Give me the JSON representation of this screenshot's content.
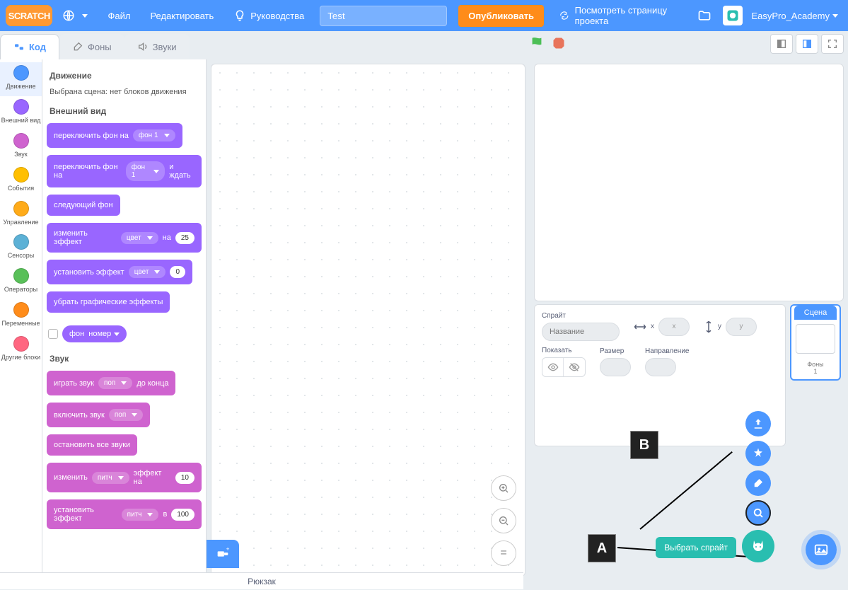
{
  "menubar": {
    "logo_text": "SCRATCH",
    "file": "Файл",
    "edit": "Редактировать",
    "tutorials": "Руководства",
    "project_name": "Test",
    "publish": "Опубликовать",
    "see_project": "Посмотреть страницу проекта",
    "username": "EasyPro_Academy"
  },
  "tabs": {
    "code": "Код",
    "backdrops": "Фоны",
    "sounds": "Звуки"
  },
  "categories": [
    {
      "label": "Движение",
      "color": "#4c97ff",
      "active": true
    },
    {
      "label": "Внешний вид",
      "color": "#9966ff"
    },
    {
      "label": "Звук",
      "color": "#cf63cf"
    },
    {
      "label": "События",
      "color": "#ffbf00"
    },
    {
      "label": "Управление",
      "color": "#ffab19"
    },
    {
      "label": "Сенсоры",
      "color": "#5cb1d6"
    },
    {
      "label": "Операторы",
      "color": "#59c059"
    },
    {
      "label": "Переменные",
      "color": "#ff8c1a"
    },
    {
      "label": "Другие блоки",
      "color": "#ff6680"
    }
  ],
  "palette": {
    "motion": {
      "header": "Движение",
      "info": "Выбрана сцена: нет блоков движения"
    },
    "looks": {
      "header": "Внешний вид",
      "blocks": {
        "switch_backdrop": "переключить фон на",
        "backdrop_opt": "фон 1",
        "switch_backdrop_wait": "переключить фон на",
        "and_wait": "и ждать",
        "next_backdrop": "следующий фон",
        "change_effect": "изменить эффект",
        "color_opt": "цвет",
        "by": "на",
        "change_val": "25",
        "set_effect": "установить эффект",
        "set_val": "0",
        "clear_effects": "убрать графические эффекты",
        "reporter_backdrop": "фон",
        "reporter_number": "номер"
      }
    },
    "sound": {
      "header": "Звук",
      "blocks": {
        "play_until": "играть звук",
        "pop": "поп",
        "until_done": "до конца",
        "play": "включить звук",
        "stop_all": "остановить все звуки",
        "change_effect": "изменить",
        "pitch": "питч",
        "effect_by": "эффект на",
        "ch_val": "10",
        "set_effect": "установить эффект",
        "in": "в",
        "set_val": "100"
      }
    }
  },
  "sprite_info": {
    "sprite_label": "Спрайт",
    "name_placeholder": "Название",
    "x_label": "x",
    "x_placeholder": "x",
    "y_label": "y",
    "y_placeholder": "y",
    "show_label": "Показать",
    "size_label": "Размер",
    "direction_label": "Направление"
  },
  "scene": {
    "header": "Сцена",
    "backdrops_label": "Фоны",
    "backdrops_count": "1"
  },
  "tooltip": {
    "choose_sprite": "Выбрать спрайт"
  },
  "markers": {
    "a": "A",
    "b": "B"
  },
  "backpack": "Рюкзак"
}
